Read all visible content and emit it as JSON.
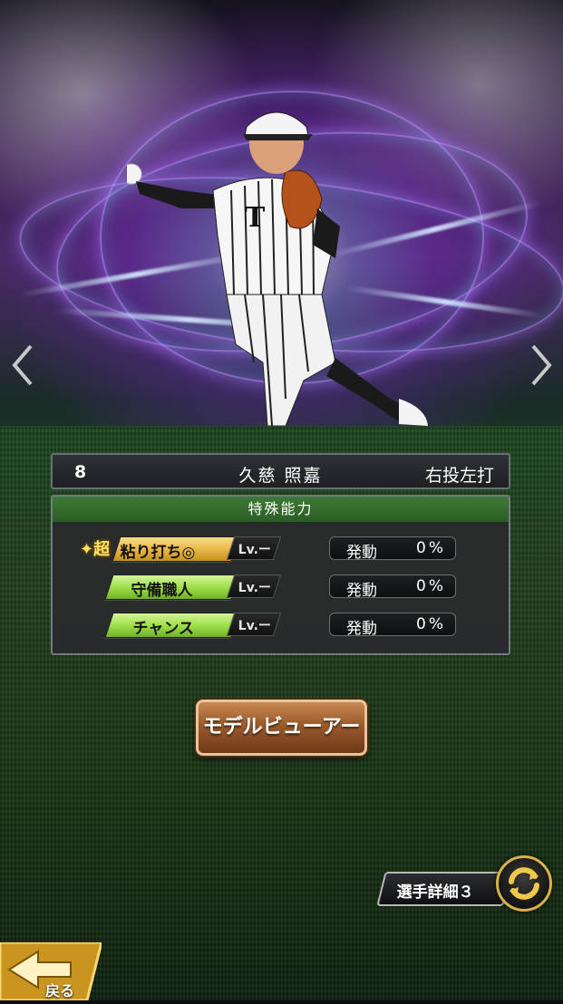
{
  "player": {
    "number": "8",
    "name": "久慈 照嘉",
    "handedness": "右投左打"
  },
  "abilities_panel": {
    "title": "特殊能力",
    "items": [
      {
        "badge": "超",
        "name": "粘り打ち◎",
        "level": "Lv.ー",
        "status_label": "発動",
        "status_value": "0%",
        "tier": "gold"
      },
      {
        "badge": "",
        "name": "守備職人",
        "level": "Lv.ー",
        "status_label": "発動",
        "status_value": "0%",
        "tier": "green"
      },
      {
        "badge": "",
        "name": "チャンス",
        "level": "Lv.ー",
        "status_label": "発動",
        "status_value": "0%",
        "tier": "green"
      }
    ]
  },
  "buttons": {
    "model_viewer": "モデルビューアー",
    "player_detail": "選手詳細３",
    "back": "戻る"
  },
  "icons": {
    "prev": "chevron-left-icon",
    "next": "chevron-right-icon",
    "cycle": "cycle-arrows-icon",
    "back": "back-arrow-icon"
  },
  "colors": {
    "ability_gold": "#e9b84a",
    "ability_green": "#9fe04a",
    "panel_header": "#3d7a33",
    "button_brown": "#9a5a2c"
  }
}
